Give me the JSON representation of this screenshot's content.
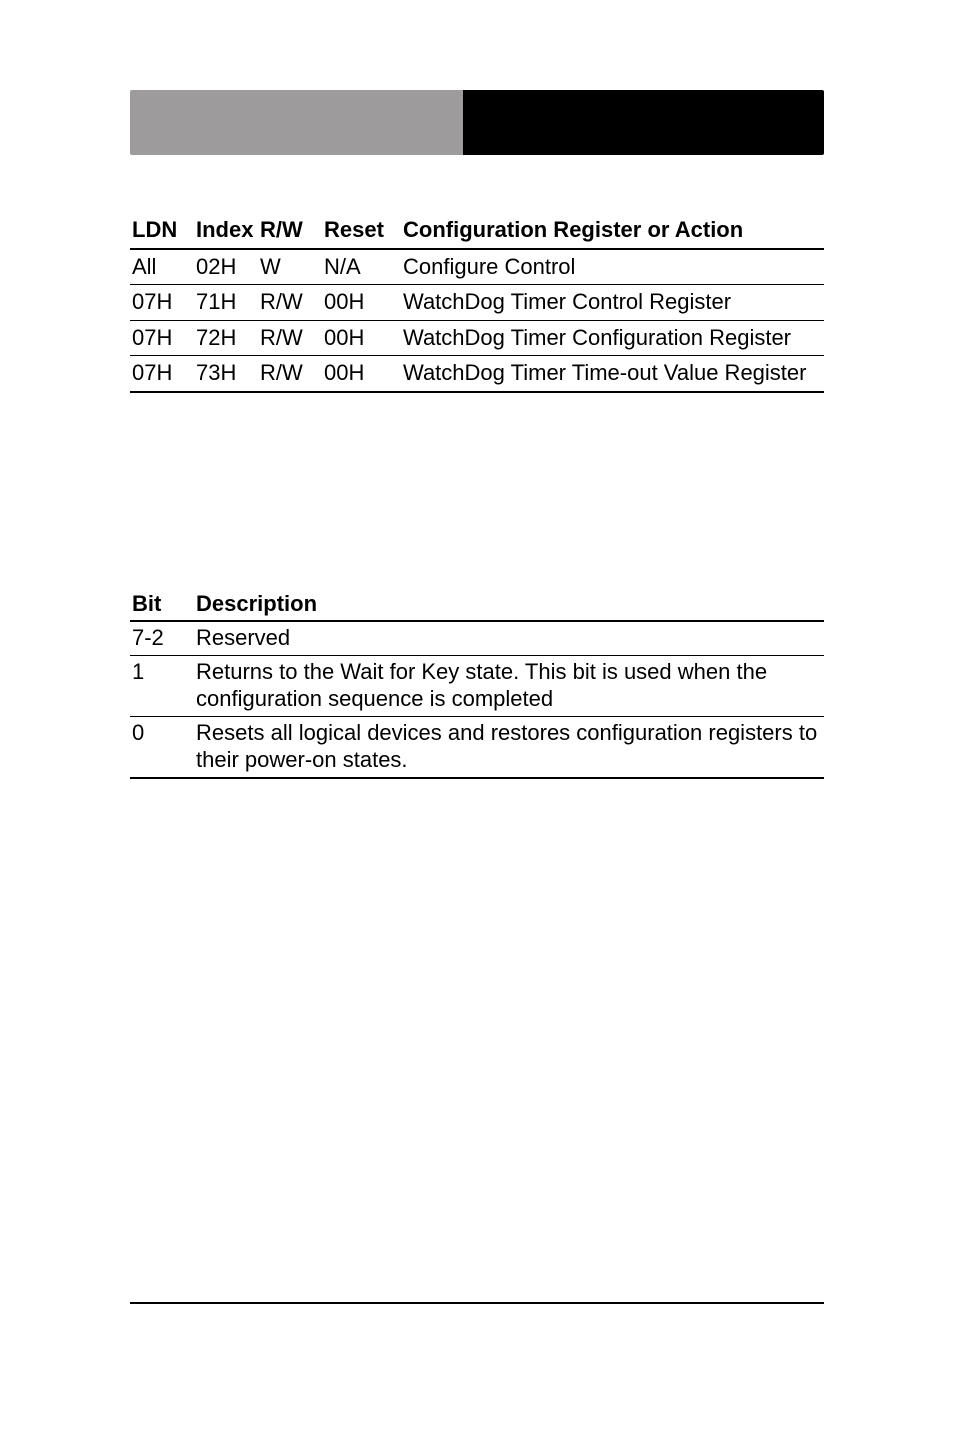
{
  "register_table": {
    "headers": {
      "ldn": "LDN",
      "index": "Index",
      "rw": "R/W",
      "reset": "Reset",
      "config": "Configuration Register or Action"
    },
    "rows": [
      {
        "ldn": "All",
        "index": "02H",
        "rw": "W",
        "reset": "N/A",
        "config": "Configure Control"
      },
      {
        "ldn": "07H",
        "index": "71H",
        "rw": "R/W",
        "reset": "00H",
        "config": "WatchDog Timer Control Register"
      },
      {
        "ldn": "07H",
        "index": "72H",
        "rw": "R/W",
        "reset": "00H",
        "config": "WatchDog Timer Configuration Register"
      },
      {
        "ldn": "07H",
        "index": "73H",
        "rw": "R/W",
        "reset": "00H",
        "config": "WatchDog Timer Time-out Value Register"
      }
    ]
  },
  "bit_table": {
    "headers": {
      "bit": "Bit",
      "desc": "Description"
    },
    "rows": [
      {
        "bit": "7-2",
        "desc": "Reserved"
      },
      {
        "bit": "1",
        "desc": "Returns to the Wait for Key state. This bit is used when the configuration sequence is completed"
      },
      {
        "bit": "0",
        "desc": "Resets all logical devices and restores configuration registers to their power-on states."
      }
    ]
  }
}
